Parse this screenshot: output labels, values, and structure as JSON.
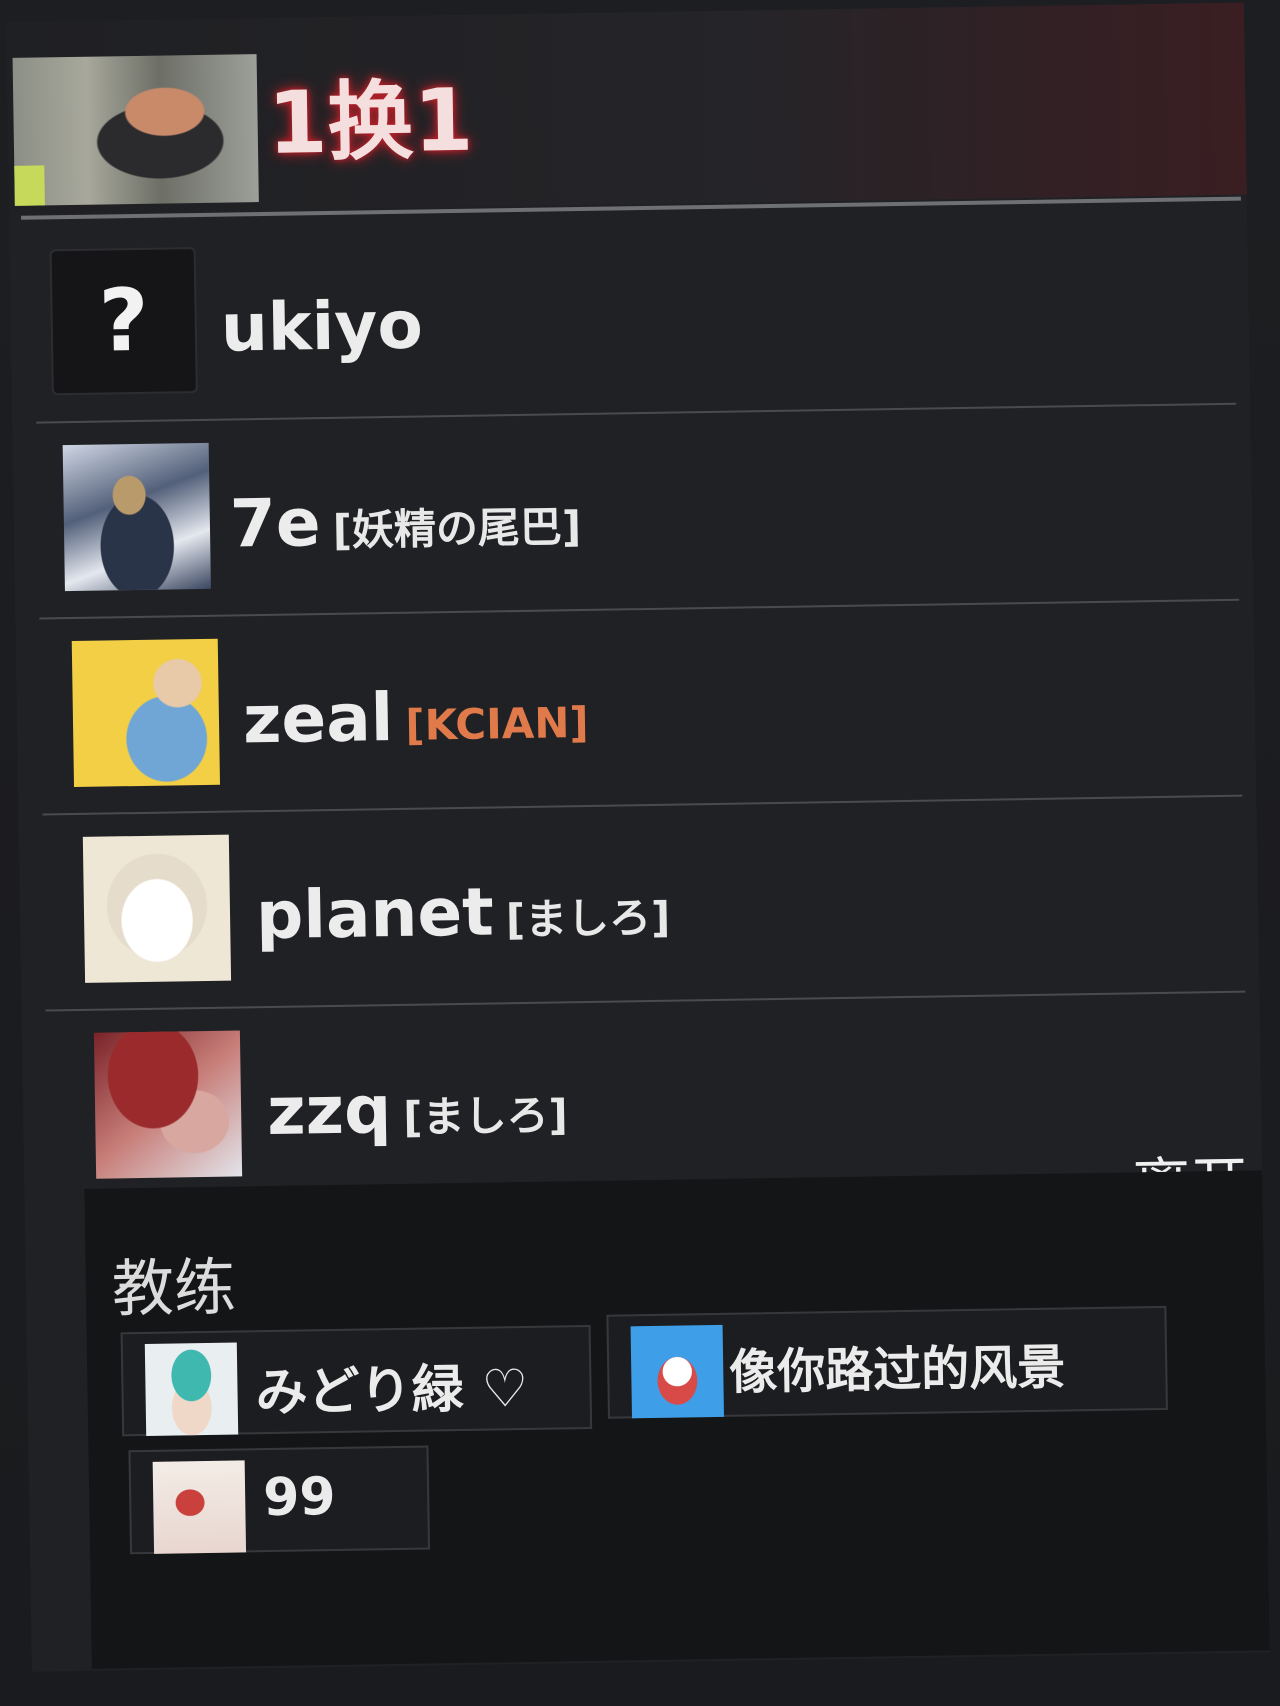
{
  "header": {
    "title": "1换1",
    "avatar_icon": "user-avatar-photo"
  },
  "players": [
    {
      "name": "ukiyo",
      "team": "",
      "avatar_icon": "question-mark-icon",
      "avatar_symbol": "?"
    },
    {
      "name": "7e",
      "team": "[妖精の尾巴]",
      "avatar_icon": "avatar-anime-dark"
    },
    {
      "name": "zeal",
      "team": "[KCIAN]",
      "team_color": "#e07a4a",
      "avatar_icon": "avatar-cartoon-child"
    },
    {
      "name": "planet",
      "team": "[ましろ]",
      "avatar_icon": "avatar-white-cat"
    },
    {
      "name": "zzq",
      "team": "[ましろ]",
      "avatar_icon": "avatar-red-hair-anime"
    }
  ],
  "leave_label": "离开",
  "coaches": {
    "title": "教练",
    "items": [
      {
        "name": "みどり緑 ♡",
        "avatar_icon": "avatar-green-hair-anime"
      },
      {
        "name": "像你路过的风景",
        "avatar_icon": "avatar-crayon-shin-chan"
      },
      {
        "name": "99",
        "avatar_icon": "avatar-red-sketch"
      }
    ]
  },
  "colors": {
    "header_glow": "#c4202a",
    "accent_team": "#e07a4a",
    "panel_bg": "#202124"
  }
}
